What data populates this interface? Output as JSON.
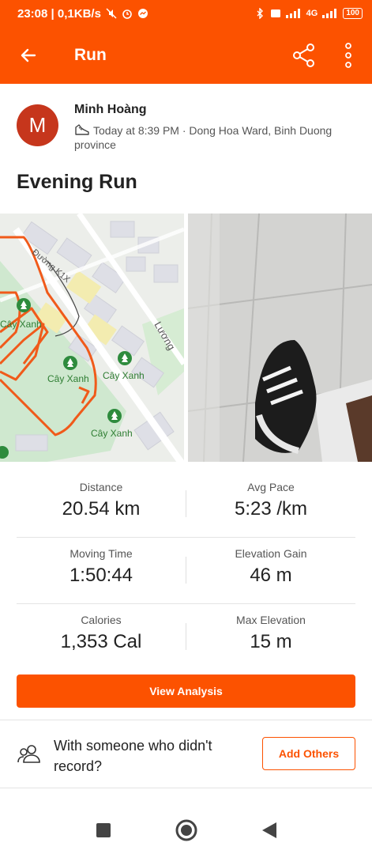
{
  "status_bar": {
    "time_speed": "23:08 | 0,1KB/s",
    "network": "4G",
    "battery": "100"
  },
  "app_bar": {
    "title": "Run",
    "back_icon": "arrow-left-icon",
    "share_icon": "share-icon",
    "more_icon": "more-vertical-icon"
  },
  "athlete": {
    "avatar_initial": "M",
    "name": "Minh Hoàng",
    "meta": "Today at 8:39 PM · Dong Hoa Ward, Binh Duong province"
  },
  "activity": {
    "title": "Evening Run"
  },
  "map": {
    "street_1": "Đường K1X",
    "street_2": "Lương",
    "poi_label": "Cây Xanh",
    "poi_label_2": "Cây Xanh",
    "poi_label_3": "Cây Xanh",
    "poi_label_4": "Cây Xanh",
    "route_color": "#f05a1a"
  },
  "stats": [
    {
      "left": {
        "label": "Distance",
        "value": "20.54 km"
      },
      "right": {
        "label": "Avg Pace",
        "value": "5:23 /km"
      }
    },
    {
      "left": {
        "label": "Moving Time",
        "value": "1:50:44"
      },
      "right": {
        "label": "Elevation Gain",
        "value": "46 m"
      }
    },
    {
      "left": {
        "label": "Calories",
        "value": "1,353 Cal"
      },
      "right": {
        "label": "Max Elevation",
        "value": "15 m"
      }
    }
  ],
  "actions": {
    "view_analysis": "View Analysis",
    "others_text": "With someone who didn't record?",
    "add_others": "Add Others"
  },
  "colors": {
    "brand": "#fc5200"
  }
}
